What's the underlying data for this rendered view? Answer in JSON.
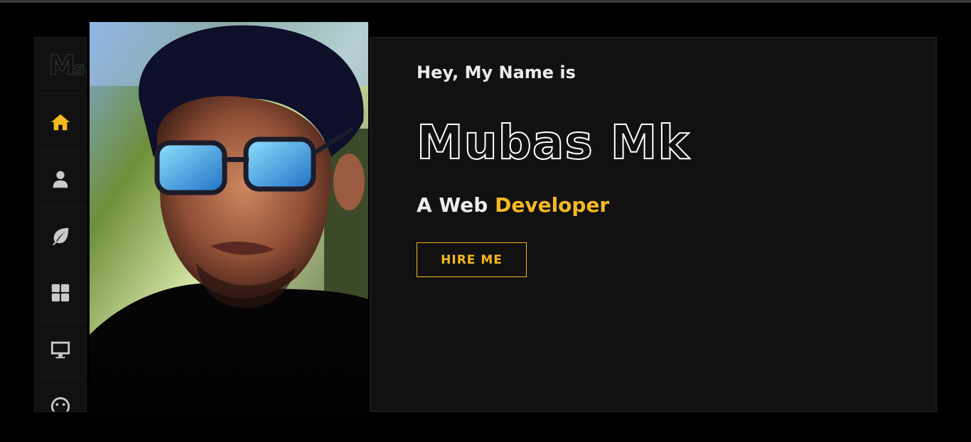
{
  "logo": {
    "main": "M",
    "sub": "s"
  },
  "nav": {
    "items": [
      {
        "name": "home",
        "icon": "home-icon",
        "active": true
      },
      {
        "name": "about",
        "icon": "user-icon",
        "active": false
      },
      {
        "name": "services",
        "icon": "leaf-icon",
        "active": false
      },
      {
        "name": "portfolio",
        "icon": "grid-icon",
        "active": false
      },
      {
        "name": "projects",
        "icon": "desktop-icon",
        "active": false
      },
      {
        "name": "contact",
        "icon": "smile-icon",
        "active": false
      }
    ]
  },
  "hero": {
    "greeting": "Hey, My Name is",
    "name": "Mubas Mk",
    "role_prefix": "A Web ",
    "role_highlight": "Developer",
    "cta_label": "HIRE ME"
  },
  "colors": {
    "accent": "#f5b921",
    "panel": "#111111",
    "background": "#000000",
    "text": "#ececec"
  }
}
